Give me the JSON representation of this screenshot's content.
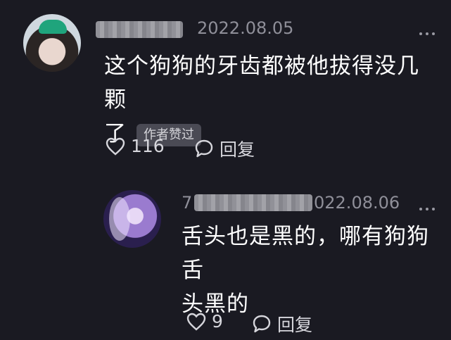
{
  "comments": [
    {
      "date": "2022.08.05",
      "text_line1": "这个狗狗的牙齿都被他拔得没几颗",
      "text_line2": "了",
      "badge": "作者赞过",
      "like_count": "116",
      "reply_label": "回复"
    },
    {
      "username_prefix": "7",
      "date": "022.08.06",
      "text_line1": "舌头也是黑的，哪有狗狗舌",
      "text_line2": "头黑的",
      "like_count": "9",
      "reply_label": "回复"
    }
  ],
  "icons": {
    "like": "heart-icon",
    "reply": "speech-bubble-icon",
    "more": "more-dots-icon"
  },
  "colors": {
    "background": "#1a1a22",
    "text": "#ffffff",
    "meta": "#8f8f99",
    "badge_bg": "#4a4a54"
  }
}
